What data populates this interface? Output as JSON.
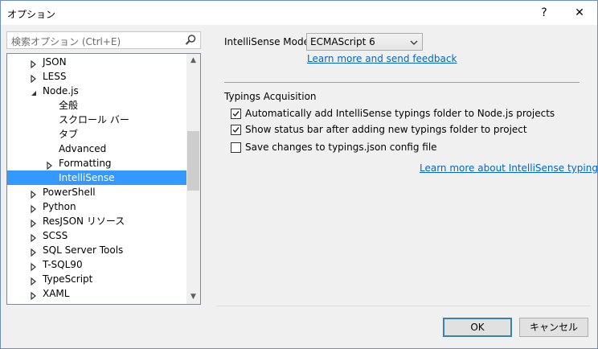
{
  "window": {
    "title": "オプション",
    "help_glyph": "?",
    "close_glyph": "✕"
  },
  "search": {
    "placeholder": "検索オプション (Ctrl+E)"
  },
  "tree": {
    "items": [
      {
        "label": "JSON",
        "arrow": "collapsed"
      },
      {
        "label": "LESS",
        "arrow": "collapsed"
      },
      {
        "label": "Node.js",
        "arrow": "expanded"
      },
      {
        "label": "全般",
        "arrow": "none"
      },
      {
        "label": "スクロール バー",
        "arrow": "none"
      },
      {
        "label": "タブ",
        "arrow": "none"
      },
      {
        "label": "Advanced",
        "arrow": "none"
      },
      {
        "label": "Formatting",
        "arrow": "collapsed"
      },
      {
        "label": "IntelliSense",
        "arrow": "none",
        "selected": true
      },
      {
        "label": "PowerShell",
        "arrow": "collapsed"
      },
      {
        "label": "Python",
        "arrow": "collapsed"
      },
      {
        "label": "ResJSON リソース",
        "arrow": "collapsed"
      },
      {
        "label": "SCSS",
        "arrow": "collapsed"
      },
      {
        "label": "SQL Server Tools",
        "arrow": "collapsed"
      },
      {
        "label": "T-SQL90",
        "arrow": "collapsed"
      },
      {
        "label": "TypeScript",
        "arrow": "collapsed"
      },
      {
        "label": "XAML",
        "arrow": "collapsed"
      }
    ]
  },
  "main": {
    "mode_label": "IntelliSense Mode:",
    "mode_value": "ECMAScript 6",
    "learn_more_link": "Learn more and send feedback",
    "section_title": "Typings Acquisition",
    "options": [
      {
        "label": "Automatically add IntelliSense typings folder to Node.js projects",
        "checked": true
      },
      {
        "label": "Show status bar after adding new typings folder to project",
        "checked": true
      },
      {
        "label": "Save changes to typings.json config file",
        "checked": false
      }
    ],
    "typings_link": "Learn more about IntelliSense typings"
  },
  "buttons": {
    "ok": "OK",
    "cancel": "キャンセル"
  },
  "colors": {
    "selection": "#3399ff",
    "link": "#0066cc",
    "default_button_border": "#3c7fb1"
  }
}
